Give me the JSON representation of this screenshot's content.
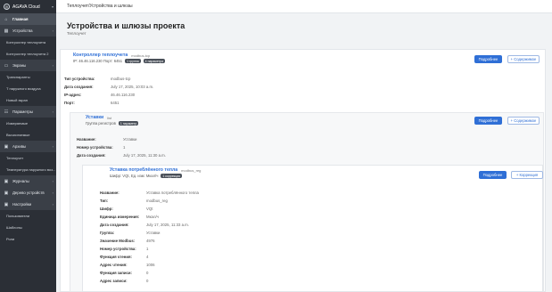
{
  "sidebar": {
    "brand": "AGAVA Cloud",
    "items": [
      {
        "label": "Главная",
        "icon": "home-icon",
        "type": "active"
      },
      {
        "label": "Устройства",
        "icon": "devices-icon",
        "type": "section",
        "arrow": "›"
      },
      {
        "label": "Контроллер теплоучета",
        "type": "sub"
      },
      {
        "label": "Контроллер теплоучета 2",
        "type": "sub"
      },
      {
        "label": "Экраны",
        "icon": "screens-icon",
        "type": "section",
        "arrow": "›"
      },
      {
        "label": "Транспаранты",
        "type": "sub"
      },
      {
        "label": "Т наружного воздуха",
        "type": "sub"
      },
      {
        "label": "Новый экран",
        "type": "sub"
      },
      {
        "label": "Параметры",
        "icon": "params-icon",
        "type": "section",
        "arrow": "›"
      },
      {
        "label": "Измеряемые",
        "type": "sub"
      },
      {
        "label": "Вычисляемые",
        "type": "sub"
      },
      {
        "label": "Архивы",
        "icon": "folder-icon",
        "type": "section",
        "arrow": "›"
      },
      {
        "label": "Теплоучет",
        "type": "sub"
      },
      {
        "label": "Температура наружного воз...",
        "type": "sub"
      },
      {
        "label": "Журналы",
        "icon": "folder-icon",
        "type": "section",
        "arrow": "›"
      },
      {
        "label": "Дерево устройств",
        "icon": "folder-icon",
        "type": "section",
        "arrow": "›"
      },
      {
        "label": "Настройки",
        "icon": "folder-icon",
        "type": "section",
        "arrow": "›"
      },
      {
        "label": "Пользователи",
        "type": "sub"
      },
      {
        "label": "Шаблоны",
        "type": "sub"
      },
      {
        "label": "Роли",
        "type": "sub"
      }
    ]
  },
  "topbar": {
    "breadcrumb": "Теплоучет/Устройства и шлюзы"
  },
  "page": {
    "title": "Устройства и шлюзы проекта",
    "subtitle": "Теплоучет"
  },
  "device": {
    "title": "Контроллер теплоучета",
    "tag": "modbus-tcp",
    "ip_port": "IP: 46.46.116.230  Порт: 6451",
    "badge1": "1 группа",
    "badge2": "4 параметра",
    "btn_details": "Подробнее",
    "btn_contents": "+ Содержимое",
    "props": [
      {
        "k": "Тип устройства:",
        "v": "modbus-tcp"
      },
      {
        "k": "Дата создания:",
        "v": "July 17, 2025, 10:03 a.m."
      },
      {
        "k": "IP-адрес:",
        "v": "46.46.116.230"
      },
      {
        "k": "Порт:",
        "v": "6451"
      }
    ]
  },
  "group": {
    "title": "Уставки",
    "tag": "list",
    "sub": "Группа регистров",
    "badge": "1 параметр",
    "btn_details": "Подробнее",
    "btn_contents": "+ Содержимое",
    "props": [
      {
        "k": "Название:",
        "v": "Уставки"
      },
      {
        "k": "Номер устройства:",
        "v": "1"
      },
      {
        "k": "Дата создания:",
        "v": "July 17, 2025, 11:30 a.m."
      }
    ]
  },
  "param": {
    "title": "Уставка потреблённого тепла",
    "tag": "modbus_reg",
    "sub": "Шифр: VQt, Ед. изм: Мкал/ч",
    "badge": "1 коррекция",
    "btn_details": "Подробнее",
    "btn_correction": "+ Коррекция",
    "props": [
      {
        "k": "Название:",
        "v": "Уставка потреблённого тепла"
      },
      {
        "k": "Тип:",
        "v": "modbus_reg"
      },
      {
        "k": "Шифр:",
        "v": "VQt"
      },
      {
        "k": "Единица измерения:",
        "v": "Мкал/ч"
      },
      {
        "k": "Дата создания:",
        "v": "July 17, 2025, 11:33 a.m."
      },
      {
        "k": "Группа:",
        "v": "Уставки"
      },
      {
        "k": "Значение Modbus:",
        "v": "4976"
      },
      {
        "k": "Номер устройства:",
        "v": "1"
      },
      {
        "k": "Функция чтения:",
        "v": "4"
      },
      {
        "k": "Адрес чтения:",
        "v": "1006"
      },
      {
        "k": "Функция записи:",
        "v": "0"
      },
      {
        "k": "Адрес записи:",
        "v": "0"
      }
    ]
  }
}
